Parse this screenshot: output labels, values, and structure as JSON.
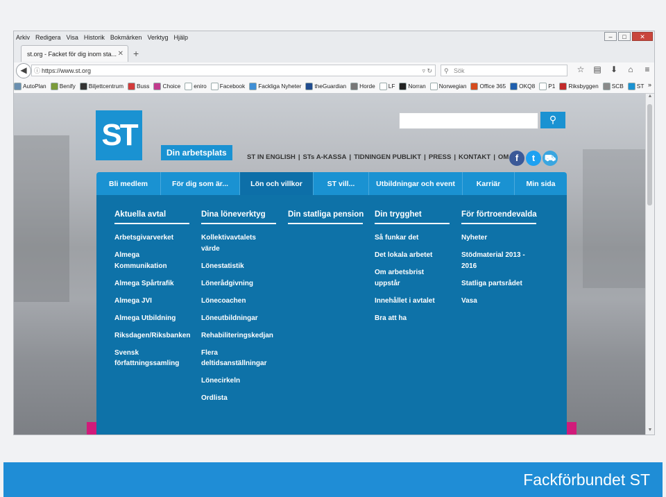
{
  "browser": {
    "menu": [
      "Arkiv",
      "Redigera",
      "Visa",
      "Historik",
      "Bokmärken",
      "Verktyg",
      "Hjälp"
    ],
    "tab_title": "st.org - Facket för dig inom sta...",
    "url": "https://www.st.org",
    "search_placeholder": "Sök",
    "bookmarks": [
      {
        "label": "AutoPlan",
        "color": "#6a8fb0"
      },
      {
        "label": "Benify",
        "color": "#7b9b3a"
      },
      {
        "label": "Biljettcentrum",
        "color": "#333333"
      },
      {
        "label": "Buss",
        "color": "#d33b3b"
      },
      {
        "label": "Choice",
        "color": "#c23b8e"
      },
      {
        "label": "eniro",
        "color": "#ffffff"
      },
      {
        "label": "Facebook",
        "color": "#ffffff"
      },
      {
        "label": "Fackliga Nyheter",
        "color": "#3f8fd6"
      },
      {
        "label": "theGuardian",
        "color": "#214c8f"
      },
      {
        "label": "Horde",
        "color": "#777777"
      },
      {
        "label": "LF",
        "color": "#ffffff"
      },
      {
        "label": "Norran",
        "color": "#222222"
      },
      {
        "label": "Norwegian",
        "color": "#ffffff"
      },
      {
        "label": "Office 365",
        "color": "#d64c1e"
      },
      {
        "label": "OKQ8",
        "color": "#1f5fae"
      },
      {
        "label": "P1",
        "color": "#ffffff"
      },
      {
        "label": "Riksbyggen",
        "color": "#c22a2a"
      },
      {
        "label": "SCB",
        "color": "#8a8a8a"
      },
      {
        "label": "ST",
        "color": "#1a92d2"
      }
    ]
  },
  "site": {
    "logo": "ST",
    "tagline": "Din arbetsplats",
    "top_links": [
      "ST IN ENGLISH",
      "STs A-KASSA",
      "TIDNINGEN PUBLIKT",
      "PRESS",
      "KONTAKT",
      "OM ST"
    ],
    "nav": [
      "Bli medlem",
      "För dig som är...",
      "Lön och villkor",
      "ST vill...",
      "Utbildningar och event",
      "Karriär",
      "Min sida"
    ],
    "mega_columns": [
      {
        "title": "Aktuella avtal",
        "items": [
          "Arbetsgivarverket",
          "Almega Kommunikation",
          "Almega Spårtrafik",
          "Almega JVI",
          "Almega Utbildning",
          "Riksdagen/Riksbanken",
          "Svensk författningssamling"
        ]
      },
      {
        "title": "Dina löneverktyg",
        "items": [
          "Kollektivavtalets värde",
          "Lönestatistik",
          "Lönerådgivning",
          "Lönecoachen",
          "Löneutbildningar",
          "Rehabiliteringskedjan",
          "Flera deltidsanställningar",
          "Lönecirkeln",
          "Ordlista"
        ]
      },
      {
        "title": "Din statliga pension",
        "items": []
      },
      {
        "title": "Din trygghet",
        "items": [
          "Så funkar det",
          "Det lokala arbetet",
          "Om arbetsbrist uppstår",
          "Innehållet i avtalet",
          "Bra att ha"
        ]
      },
      {
        "title": "För förtroendevalda",
        "items": [
          "Nyheter",
          "Stödmaterial 2013 - 2016",
          "Statliga partsrådet",
          "Vasa"
        ]
      }
    ]
  },
  "banner": {
    "text": "Fackförbundet ST"
  },
  "colors": {
    "brand": "#1a92d2",
    "mega": "#0e72a8",
    "banner": "#1f8dd6",
    "accent": "#d11b7a"
  }
}
